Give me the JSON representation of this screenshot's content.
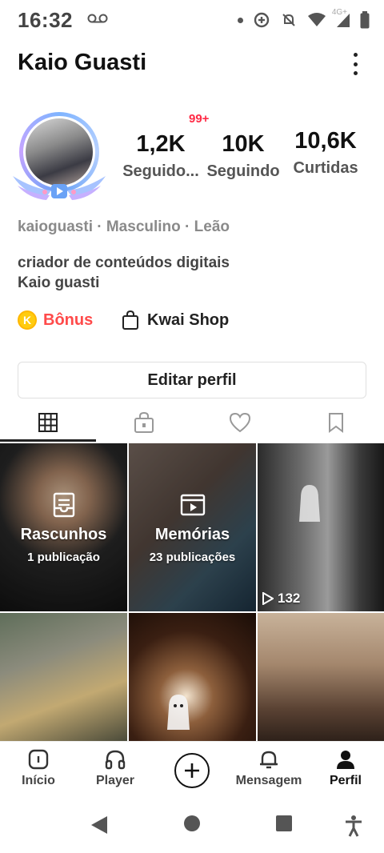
{
  "status_bar": {
    "time": "16:32",
    "network_label": "4G+",
    "icons": [
      "voicemail-icon",
      "data-saver-icon",
      "mute-icon",
      "wifi-icon",
      "signal-icon",
      "battery-icon"
    ]
  },
  "header": {
    "name": "Kaio Guasti",
    "more_icon": "more-vertical-icon"
  },
  "stats": {
    "badge": "99+",
    "followers_value": "1,2K",
    "followers_label": "Seguido...",
    "following_value": "10K",
    "following_label": "Seguindo",
    "likes_value": "10,6K",
    "likes_label": "Curtidas"
  },
  "bio": {
    "meta": "kaioguasti · Masculino · Leão",
    "line1": "criador de conteúdos digitais",
    "line2": "Kaio guasti"
  },
  "actions": {
    "bonus_coin": "K",
    "bonus_label": "Bônus",
    "shop_label": "Kwai Shop",
    "edit_profile": "Editar perfil"
  },
  "tabs": [
    {
      "icon": "grid-icon",
      "active": true
    },
    {
      "icon": "lock-bag-icon",
      "active": false
    },
    {
      "icon": "heart-icon",
      "active": false
    },
    {
      "icon": "bookmark-icon",
      "active": false
    }
  ],
  "grid": {
    "drafts_title": "Rascunhos",
    "drafts_sub": "1 publicação",
    "memories_title": "Memórias",
    "memories_sub": "23 publicações",
    "stairs_views": "132"
  },
  "bottom_nav": {
    "home": "Início",
    "player": "Player",
    "message": "Mensagem",
    "profile": "Perfil"
  },
  "colors": {
    "accent_red": "#ff2a45",
    "bonus_red": "#ff4a4a",
    "coin_yellow": "#ffcc10"
  }
}
